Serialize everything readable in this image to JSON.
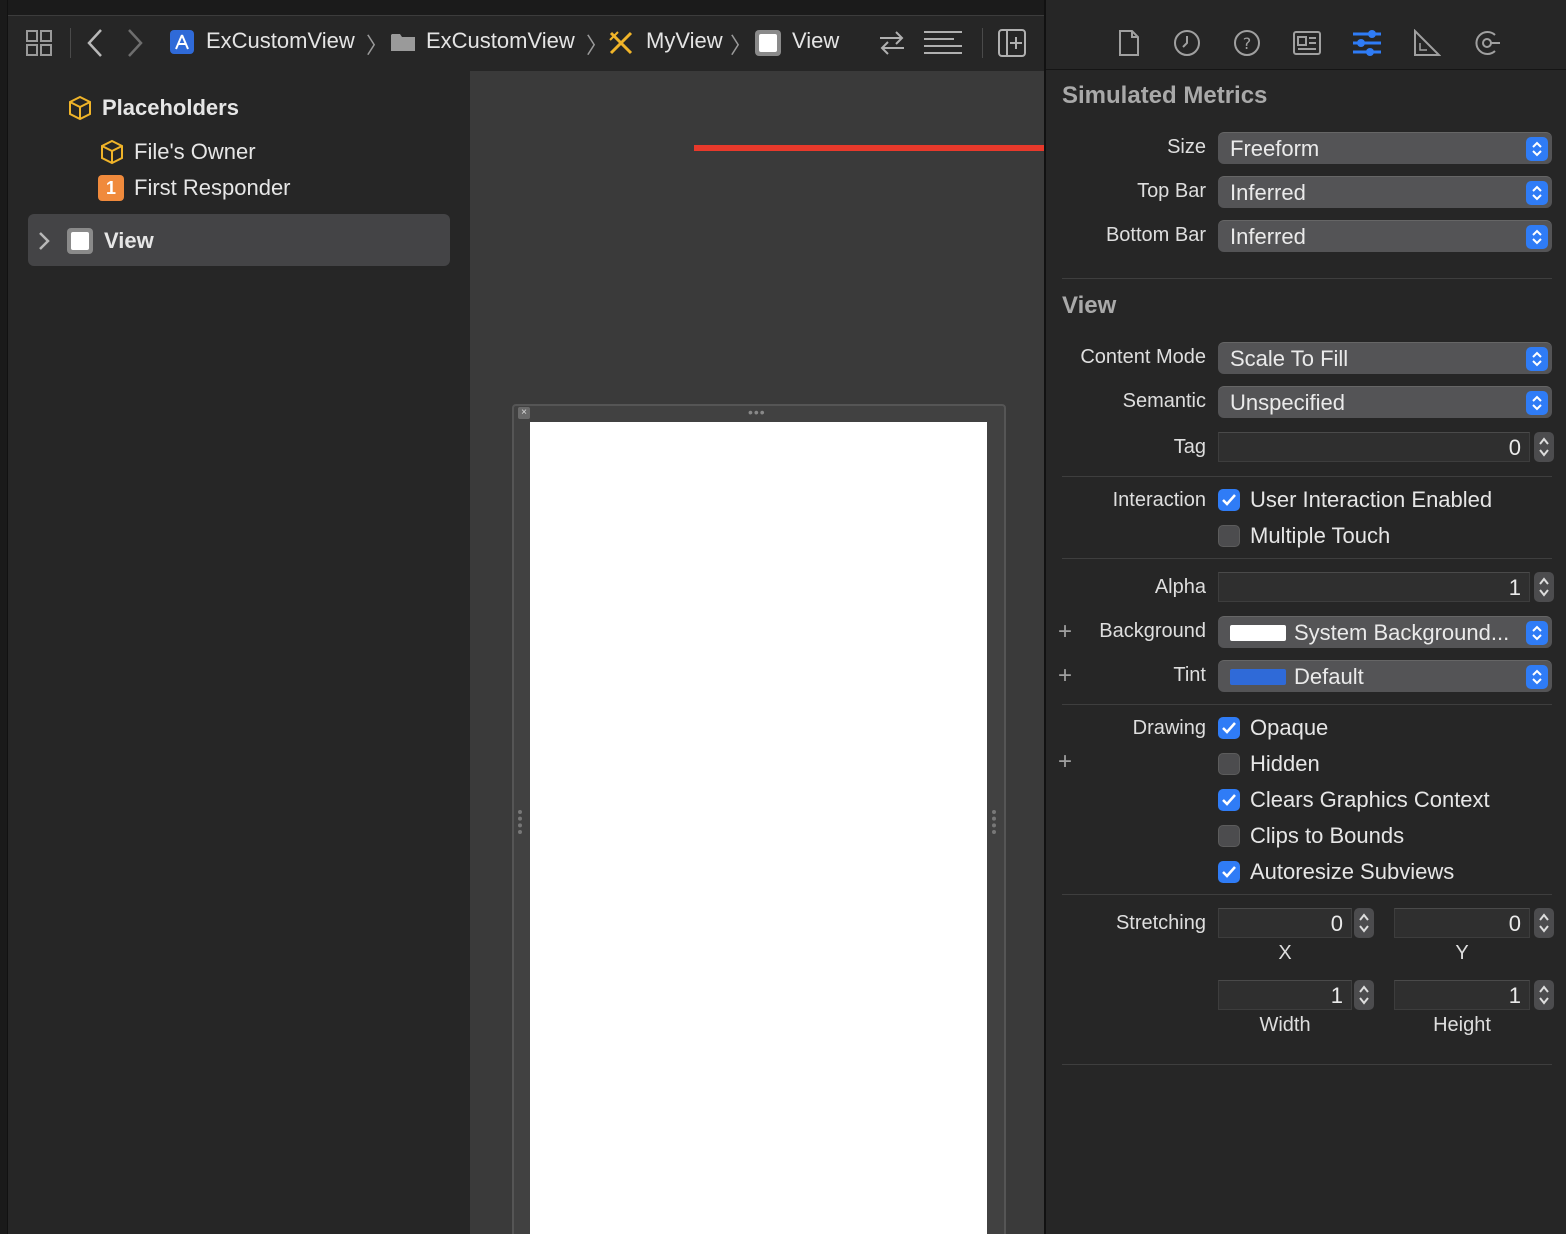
{
  "breadcrumb": {
    "items": [
      "ExCustomView",
      "ExCustomView",
      "MyView",
      "View"
    ]
  },
  "outline": {
    "placeholders_label": "Placeholders",
    "files_owner_label": "File's Owner",
    "first_responder_badge": "1",
    "first_responder_label": "First Responder",
    "view_label": "View"
  },
  "inspector": {
    "simulated_metrics": {
      "title": "Simulated Metrics",
      "size_label": "Size",
      "size_value": "Freeform",
      "top_bar_label": "Top Bar",
      "top_bar_value": "Inferred",
      "bottom_bar_label": "Bottom Bar",
      "bottom_bar_value": "Inferred"
    },
    "view": {
      "title": "View",
      "content_mode_label": "Content Mode",
      "content_mode_value": "Scale To Fill",
      "semantic_label": "Semantic",
      "semantic_value": "Unspecified",
      "tag_label": "Tag",
      "tag_value": "0",
      "interaction_label": "Interaction",
      "user_interaction_label": "User Interaction Enabled",
      "multiple_touch_label": "Multiple Touch",
      "alpha_label": "Alpha",
      "alpha_value": "1",
      "background_label": "Background",
      "background_value": "System Background...",
      "tint_label": "Tint",
      "tint_value": "Default",
      "drawing_label": "Drawing",
      "opaque_label": "Opaque",
      "hidden_label": "Hidden",
      "clears_graphics_label": "Clears Graphics Context",
      "clips_to_bounds_label": "Clips to Bounds",
      "autoresize_label": "Autoresize Subviews",
      "stretching_label": "Stretching",
      "stretch_x_value": "0",
      "stretch_y_value": "0",
      "stretch_x_label": "X",
      "stretch_y_label": "Y",
      "stretch_width_value": "1",
      "stretch_height_value": "1",
      "stretch_width_label": "Width",
      "stretch_height_label": "Height"
    }
  },
  "checkbox_states": {
    "user_interaction_enabled": true,
    "multiple_touch": false,
    "opaque": true,
    "hidden": false,
    "clears_graphics_context": true,
    "clips_to_bounds": false,
    "autoresize_subviews": true
  },
  "colors": {
    "accent": "#2f7cf6",
    "annotation_arrow": "#e8392b",
    "placeholder_icon": "#f0b429",
    "first_responder_badge": "#f08a3c",
    "tint_swatch": "#2f6ad8",
    "background_swatch": "#ffffff"
  },
  "icons": {
    "toolbar": [
      "grid-icon",
      "back-chevron-icon",
      "forward-chevron-icon",
      "xcode-app-icon",
      "folder-icon",
      "xib-file-icon",
      "view-icon",
      "swap-arrows-icon",
      "lines-menu-icon",
      "add-editor-icon"
    ],
    "inspector_tabs": [
      "file-inspector-icon",
      "history-icon",
      "help-icon",
      "identity-icon",
      "attributes-icon",
      "size-icon",
      "connections-icon"
    ]
  }
}
